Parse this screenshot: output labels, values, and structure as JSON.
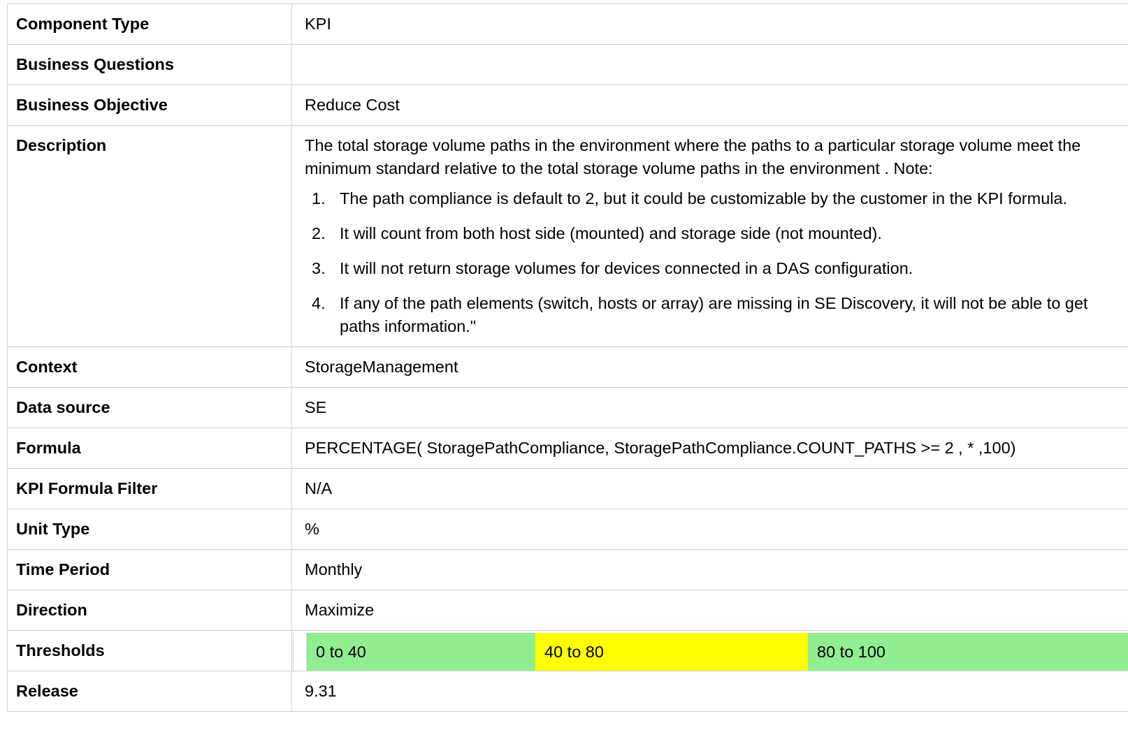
{
  "rows": {
    "component_type": {
      "label": "Component Type",
      "value": "KPI"
    },
    "business_questions": {
      "label": "Business Questions",
      "value": ""
    },
    "business_objective": {
      "label": "Business Objective",
      "value": "Reduce Cost"
    },
    "description": {
      "label": "Description",
      "text": "The total storage volume paths in the environment where the paths to a particular storage volume meet the minimum standard relative to the total storage volume paths in the environment . Note:",
      "notes": [
        {
          "num": "1.",
          "text": "The path compliance is default to 2, but it could be customizable by the customer in the KPI formula."
        },
        {
          "num": "2.",
          "text": "It will count from both host side (mounted) and storage side (not mounted)."
        },
        {
          "num": "3.",
          "text": "It will not return storage volumes for devices connected in a DAS configuration."
        },
        {
          "num": "4.",
          "text": "If any of the path elements (switch, hosts or array) are missing in SE Discovery, it will not be able to get paths information.\""
        }
      ]
    },
    "context": {
      "label": "Context",
      "value": "StorageManagement"
    },
    "data_source": {
      "label": "Data source",
      "value": "SE"
    },
    "formula": {
      "label": "Formula",
      "value": "PERCENTAGE( StoragePathCompliance, StoragePathCompliance.COUNT_PATHS >= 2 , * ,100)"
    },
    "kpi_formula_filter": {
      "label": "KPI Formula Filter",
      "value": "N/A"
    },
    "unit_type": {
      "label": "Unit Type",
      "value": "%"
    },
    "time_period": {
      "label": "Time Period",
      "value": "Monthly"
    },
    "direction": {
      "label": "Direction",
      "value": "Maximize"
    },
    "thresholds": {
      "label": "Thresholds",
      "bands": [
        {
          "text": "0 to 40",
          "color": "#90ee90"
        },
        {
          "text": "40 to 80",
          "color": "#ffff00"
        },
        {
          "text": "80 to 100",
          "color": "#90ee90"
        }
      ]
    },
    "release": {
      "label": "Release",
      "value": "9.31"
    }
  }
}
